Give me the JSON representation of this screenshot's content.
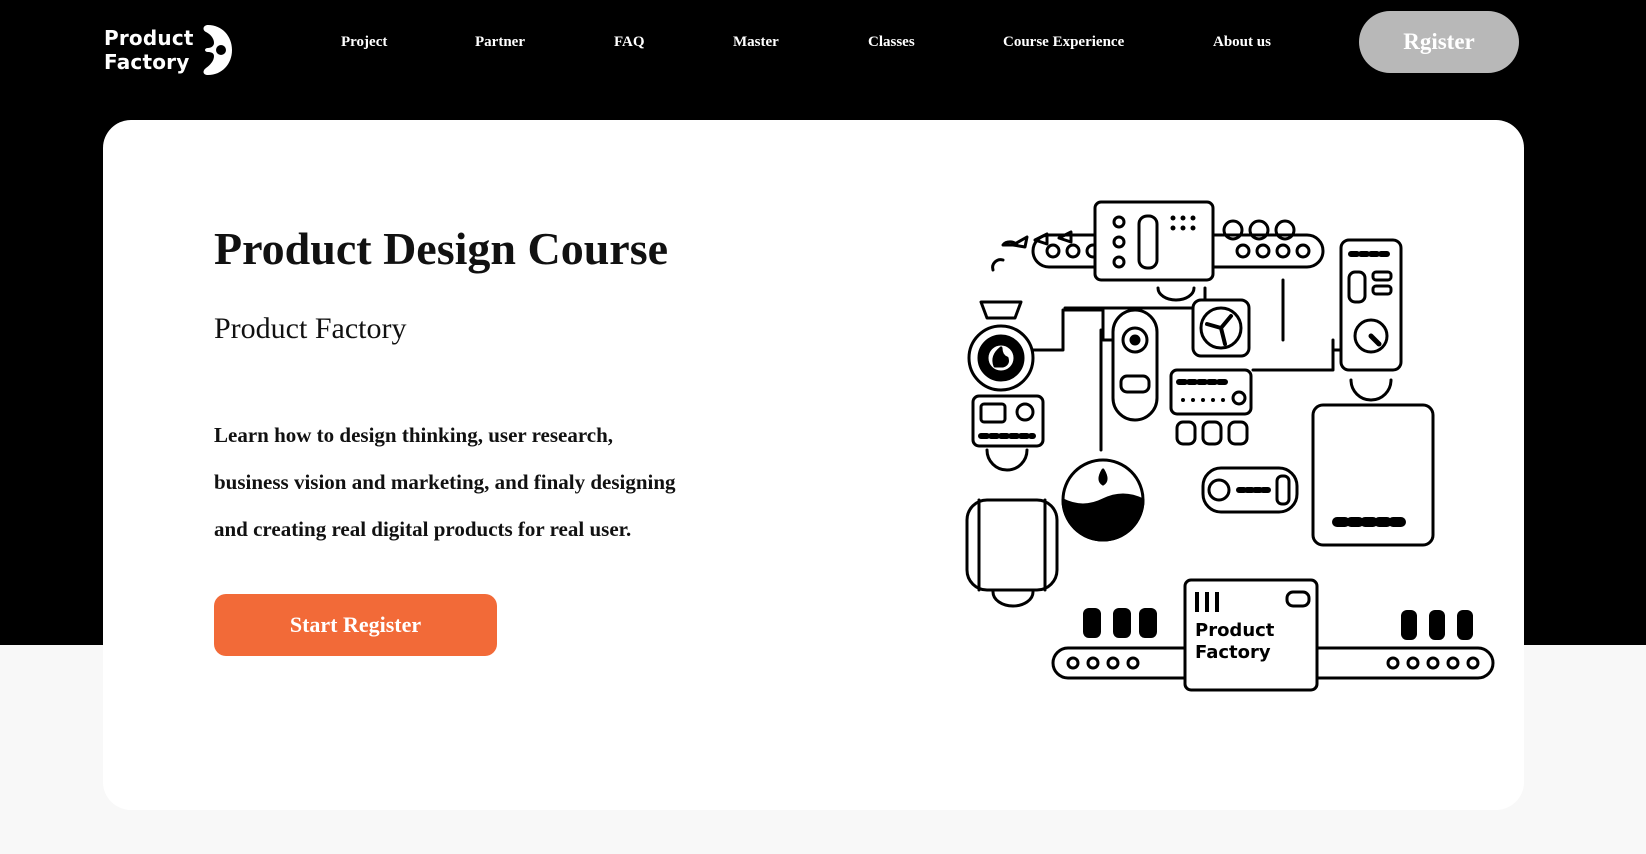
{
  "brand": {
    "line1": "Product",
    "line2": "Factory"
  },
  "nav": {
    "items": [
      "Project",
      "Partner",
      "FAQ",
      "Master",
      "Classes",
      "Course Experience",
      "About us"
    ],
    "register_label": "Rgister"
  },
  "hero": {
    "title": "Product Design Course",
    "subtitle": "Product Factory",
    "description_lines": [
      "Learn how to design thinking, user research,",
      "business vision and marketing, and finaly designing",
      "and creating real digital products for real user."
    ],
    "cta_label": "Start Register"
  },
  "illustration": {
    "label_line1": "Product",
    "label_line2": "Factory"
  },
  "colors": {
    "header_bg": "#000000",
    "accent": "#f26a38",
    "register_bg": "#b8b8b8",
    "page_bg": "#f8f8f8"
  }
}
